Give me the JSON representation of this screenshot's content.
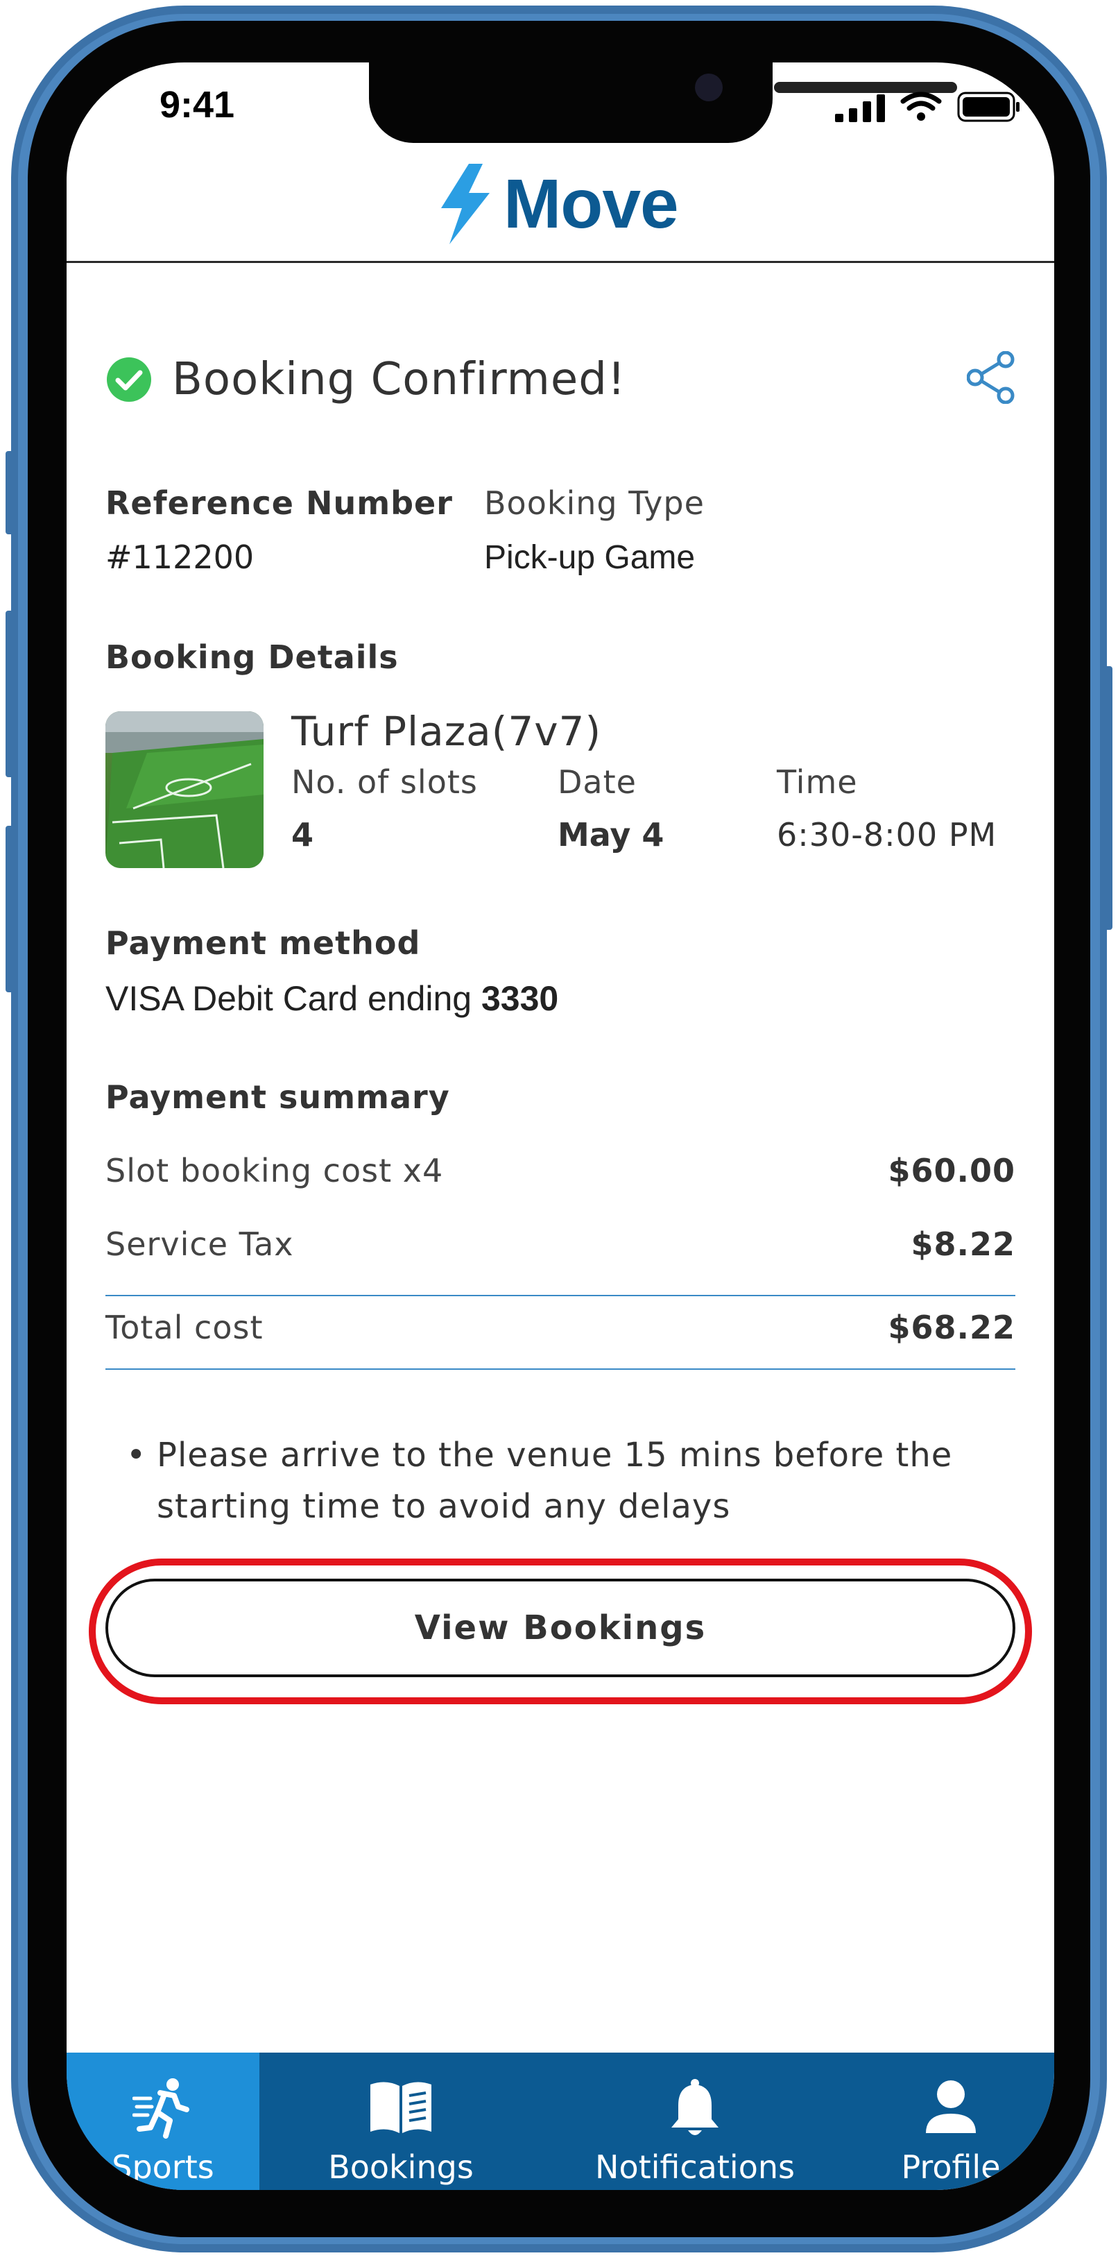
{
  "status_bar": {
    "time": "9:41"
  },
  "app": {
    "brand": "Move"
  },
  "confirmation": {
    "title": "Booking Confirmed!"
  },
  "reference": {
    "label": "Reference Number",
    "value": "#112200"
  },
  "booking_type": {
    "label": "Booking Type",
    "value": "Pick-up Game"
  },
  "booking_details": {
    "label": "Booking Details",
    "venue": "Turf Plaza(7v7)",
    "slots_label": "No. of slots",
    "slots_value": "4",
    "date_label": "Date",
    "date_value": "May 4",
    "time_label": "Time",
    "time_value": "6:30-8:00 PM"
  },
  "payment_method": {
    "label": "Payment method",
    "text": "VISA Debit Card ending ",
    "last4": "3330"
  },
  "payment_summary": {
    "label": "Payment summary",
    "rows": [
      {
        "label": "Slot booking cost x4",
        "amount": "$60.00"
      },
      {
        "label": "Service Tax",
        "amount": "$8.22"
      }
    ],
    "total_label": "Total cost",
    "total_amount": "$68.22"
  },
  "note": {
    "line1": "Please arrive to the venue 15 mins before the",
    "line2": "starting time to avoid any delays"
  },
  "actions": {
    "view_bookings": "View Bookings"
  },
  "tabs": [
    {
      "label": "Sports",
      "icon": "runner-icon",
      "active": true
    },
    {
      "label": "Bookings",
      "icon": "book-icon",
      "active": false
    },
    {
      "label": "Notifications",
      "icon": "bell-icon",
      "active": false
    },
    {
      "label": "Profile",
      "icon": "person-icon",
      "active": false
    }
  ],
  "colors": {
    "brand": "#0c5a92",
    "active_tab": "#1e8fd8",
    "success": "#3cc35a",
    "highlight": "#e3141c",
    "divider": "#3a8ac6"
  }
}
